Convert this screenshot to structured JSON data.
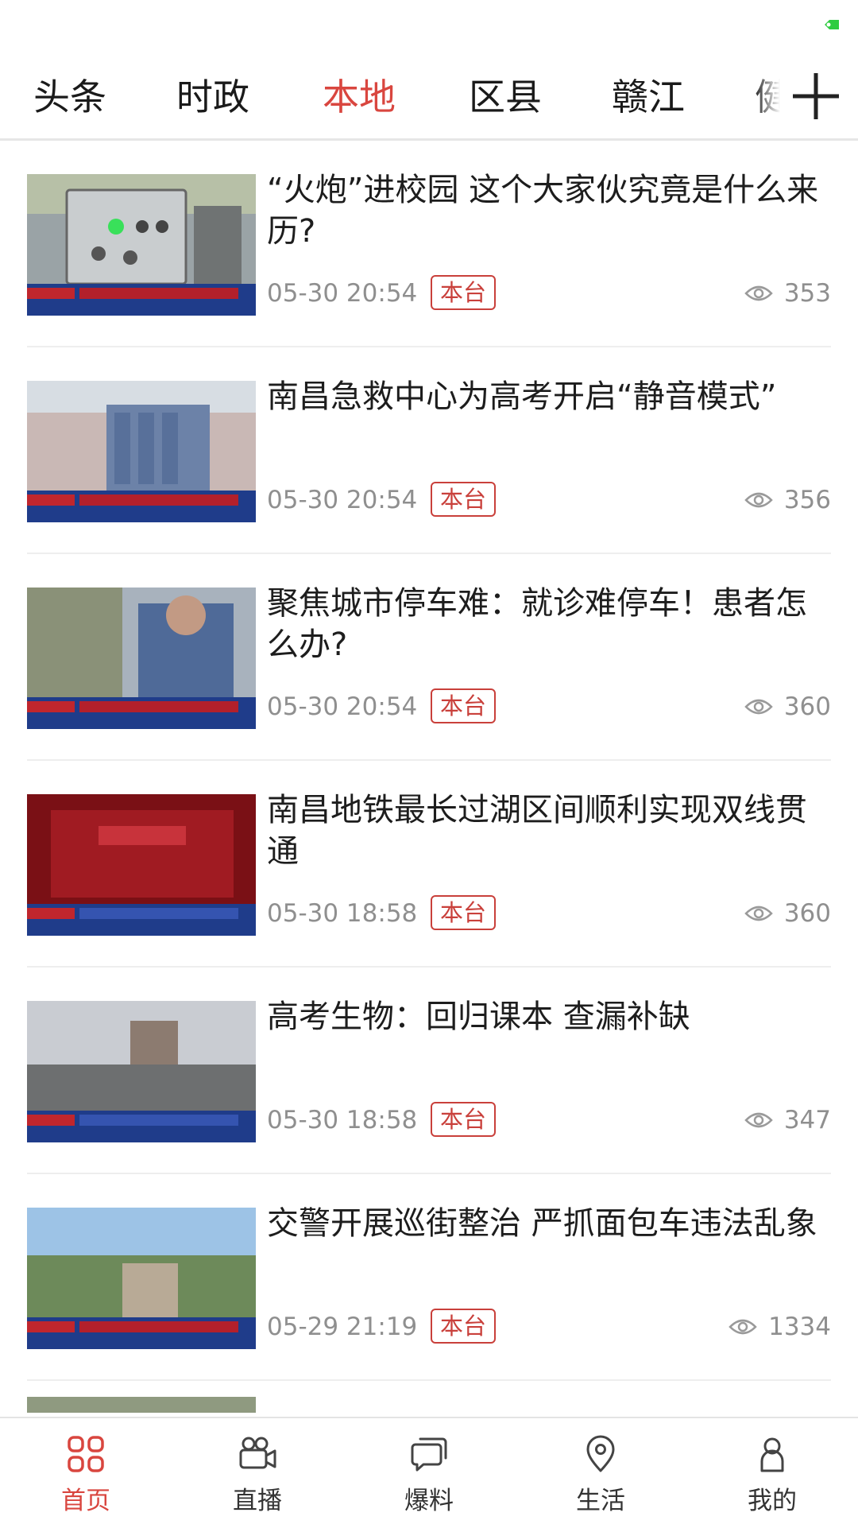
{
  "status_bar": {
    "indicator_color": "#2ecc40"
  },
  "tabs": [
    {
      "label": "头条",
      "active": false
    },
    {
      "label": "时政",
      "active": false
    },
    {
      "label": "本地",
      "active": true
    },
    {
      "label": "区县",
      "active": false
    },
    {
      "label": "赣江",
      "active": false
    },
    {
      "label": "健",
      "active": false
    }
  ],
  "tab_add_icon": "plus-icon",
  "news": [
    {
      "title": "“火炮”进校园 这个大家伙究竟是什么来历?",
      "time": "05-30 20:54",
      "badge": "本台",
      "views": "353"
    },
    {
      "title": "南昌急救中心为高考开启“静音模式”",
      "time": "05-30 20:54",
      "badge": "本台",
      "views": "356"
    },
    {
      "title": "聚焦城市停车难：就诊难停车！患者怎么办?",
      "time": "05-30 20:54",
      "badge": "本台",
      "views": "360"
    },
    {
      "title": "南昌地铁最长过湖区间顺利实现双线贯通",
      "time": "05-30 18:58",
      "badge": "本台",
      "views": "360"
    },
    {
      "title": "高考生物：回归课本 查漏补缺",
      "time": "05-30 18:58",
      "badge": "本台",
      "views": "347"
    },
    {
      "title": "交警开展巡街整治 严抓面包车违法乱象",
      "time": "05-29 21:19",
      "badge": "本台",
      "views": "1334"
    }
  ],
  "bottom_nav": [
    {
      "label": "首页",
      "icon": "home-grid-icon",
      "active": true
    },
    {
      "label": "直播",
      "icon": "video-camera-icon",
      "active": false
    },
    {
      "label": "爆料",
      "icon": "chat-bubble-icon",
      "active": false
    },
    {
      "label": "生活",
      "icon": "location-pin-icon",
      "active": false
    },
    {
      "label": "我的",
      "icon": "person-icon",
      "active": false
    }
  ],
  "colors": {
    "accent": "#d9463f",
    "badge": "#c9403b",
    "meta_text": "#8f8f8f"
  }
}
